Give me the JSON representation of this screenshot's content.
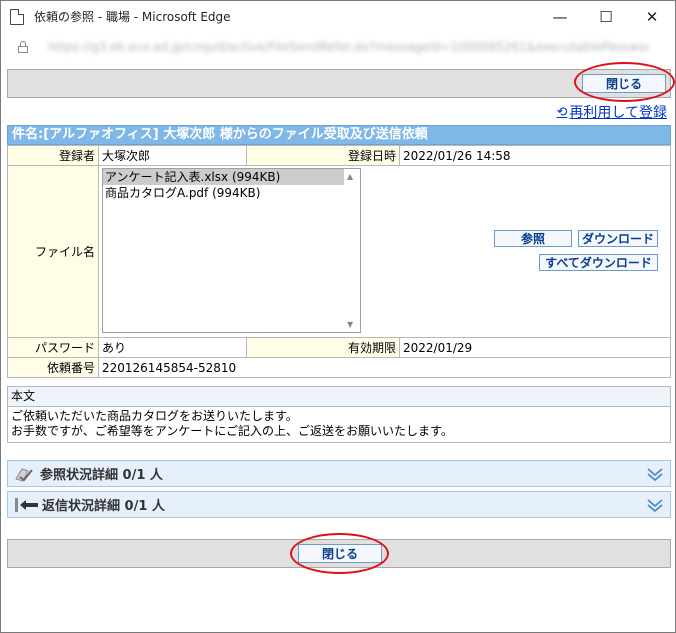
{
  "window": {
    "title": "依頼の参照 - 職場 - Microsoft Edge",
    "controls": {
      "minimize": "—",
      "maximize": "☐",
      "close": "✕"
    }
  },
  "address": {
    "url": "https://g3.ek.eco.ad.jp/cmp/d/active/FileSendRefer.do?messageId=1000085261&executablePassword"
  },
  "toolbar": {
    "close_label": "閉じる"
  },
  "reuse": {
    "label": "再利用して登録"
  },
  "form": {
    "title": "件名:[アルファオフィス] 大塚次郎 様からのファイル受取及び送信依頼",
    "registrant_label": "登録者",
    "registrant": "大塚次郎",
    "registered_at_label": "登録日時",
    "registered_at": "2022/01/26 14:58",
    "file_label": "ファイル名",
    "files": [
      {
        "name": "アンケート記入表.xlsx (994KB)",
        "selected": true
      },
      {
        "name": "商品カタログA.pdf (994KB)",
        "selected": false
      }
    ],
    "btn_refer": "参照",
    "btn_download": "ダウンロード",
    "btn_download_all": "すべてダウンロード",
    "password_label": "パスワード",
    "password": "あり",
    "expiry_label": "有効期限",
    "expiry": "2022/01/29",
    "request_no_label": "依頼番号",
    "request_no": "220126145854-52810"
  },
  "body": {
    "heading": "本文",
    "line1": "ご依頼いただいた商品カタログをお送りいたします。",
    "line2": "お手数ですが、ご希望等をアンケートにご記入の上、ご返送をお願いいたします。"
  },
  "sections": {
    "refer_status": "参照状況詳細 0/1 人",
    "reply_status": "返信状況詳細 0/1 人"
  },
  "colors": {
    "header_blue": "#7fb8e8",
    "label_yellow": "#fffde6",
    "link_blue": "#0033cc",
    "highlight_red": "#e0101a"
  }
}
